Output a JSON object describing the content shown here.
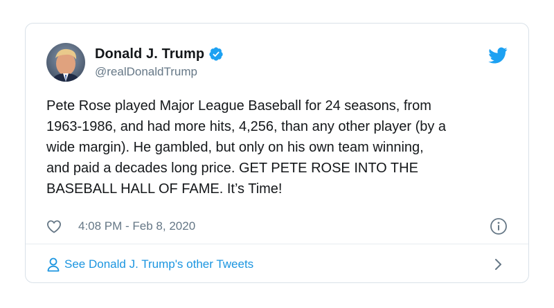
{
  "tweet": {
    "display_name": "Donald J. Trump",
    "handle": "@realDonaldTrump",
    "text": "Pete Rose played Major League Baseball for 24 seasons, from\n1963-1986, and had more hits, 4,256, than any other player (by a\nwide margin). He gambled, but only on his own team winning,\nand paid a decades long price. GET PETE ROSE INTO THE\nBASEBALL HALL OF FAME. It’s Time!",
    "timestamp": "4:08 PM - Feb 8, 2020",
    "verified": true
  },
  "footer": {
    "link_label": "See Donald J. Trump's other Tweets"
  },
  "icons": {
    "avatar": "avatar",
    "verified": "verified-badge-icon",
    "brand": "twitter-bird-icon",
    "like": "heart-icon",
    "info": "info-icon",
    "person": "person-icon",
    "chevron": "chevron-right-icon"
  },
  "colors": {
    "brand_blue": "#1da1f2",
    "link_blue": "#1b95e0",
    "secondary_text": "#657786",
    "primary_text": "#14171a",
    "border": "#d9e1e8"
  }
}
